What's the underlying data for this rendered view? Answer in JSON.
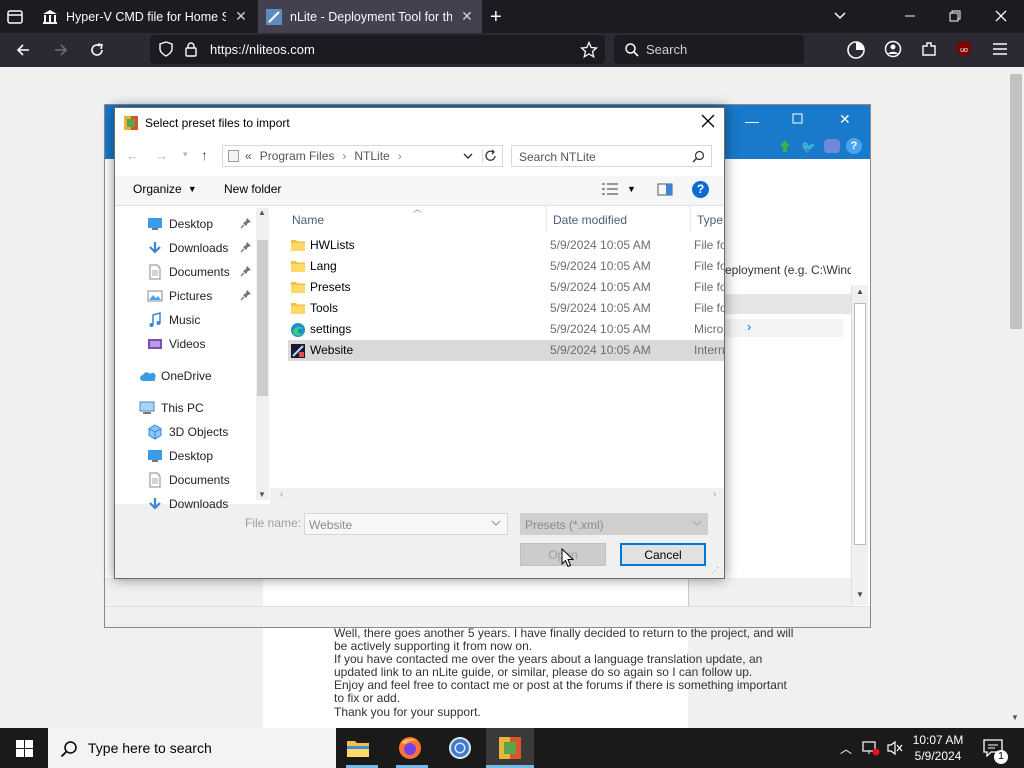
{
  "browser": {
    "tabs": [
      {
        "title": "Hyper-V CMD file for Home SKU"
      },
      {
        "title": "nLite - Deployment Tool for the"
      }
    ],
    "url": "https://nliteos.com",
    "search_placeholder": "Search"
  },
  "ntlite_window": {
    "path_hint": "eployment (e.g. C:\\Wind..."
  },
  "dialog": {
    "title": "Select preset files to import",
    "breadcrumb": [
      "«",
      "Program Files",
      "NTLite"
    ],
    "search_placeholder": "Search NTLite",
    "organize_label": "Organize",
    "new_folder_label": "New folder",
    "nav": [
      {
        "label": "Desktop",
        "pinned": true,
        "icon": "desktop-icon"
      },
      {
        "label": "Downloads",
        "pinned": true,
        "icon": "downloads-icon"
      },
      {
        "label": "Documents",
        "pinned": true,
        "icon": "documents-icon"
      },
      {
        "label": "Pictures",
        "pinned": true,
        "icon": "pictures-icon"
      },
      {
        "label": "Music",
        "pinned": false,
        "icon": "music-icon"
      },
      {
        "label": "Videos",
        "pinned": false,
        "icon": "videos-icon"
      },
      {
        "label": "OneDrive",
        "pinned": false,
        "icon": "onedrive-icon"
      },
      {
        "label": "This PC",
        "pinned": false,
        "icon": "this-pc-icon"
      },
      {
        "label": "3D Objects",
        "pinned": false,
        "icon": "3d-objects-icon"
      },
      {
        "label": "Desktop",
        "pinned": false,
        "icon": "desktop-icon"
      },
      {
        "label": "Documents",
        "pinned": false,
        "icon": "documents-icon"
      },
      {
        "label": "Downloads",
        "pinned": false,
        "icon": "downloads-icon"
      }
    ],
    "columns": {
      "name": "Name",
      "date": "Date modified",
      "type": "Type"
    },
    "files": [
      {
        "name": "HWLists",
        "date": "5/9/2024 10:05 AM",
        "type": "File fo",
        "icon": "folder-icon"
      },
      {
        "name": "Lang",
        "date": "5/9/2024 10:05 AM",
        "type": "File fo",
        "icon": "folder-icon"
      },
      {
        "name": "Presets",
        "date": "5/9/2024 10:05 AM",
        "type": "File fo",
        "icon": "folder-icon"
      },
      {
        "name": "Tools",
        "date": "5/9/2024 10:05 AM",
        "type": "File fo",
        "icon": "folder-icon"
      },
      {
        "name": "settings",
        "date": "5/9/2024 10:05 AM",
        "type": "Micro",
        "icon": "edge-icon"
      },
      {
        "name": "Website",
        "date": "5/9/2024 10:05 AM",
        "type": "Intern",
        "icon": "website-icon"
      }
    ],
    "selected_file": "Website",
    "file_name_label": "File name:",
    "file_name_value": "Website",
    "filter_value": "Presets (*.xml)",
    "open_label": "Open",
    "cancel_label": "Cancel"
  },
  "page_text": [
    "Well, there goes another 5 years. I have finally decided to return to the project, and will",
    "be actively supporting it from now on.",
    "If you have contacted me over the years about a language translation update, an",
    "updated link to an nLite guide, or similar, please do so again so I can follow up.",
    "Enjoy and feel free to contact me or post at the forums if there is something important",
    "to fix or add.",
    "Thank you for your support."
  ],
  "taskbar": {
    "search_placeholder": "Type here to search",
    "time": "10:07 AM",
    "date": "5/9/2024",
    "notification_count": "1"
  }
}
